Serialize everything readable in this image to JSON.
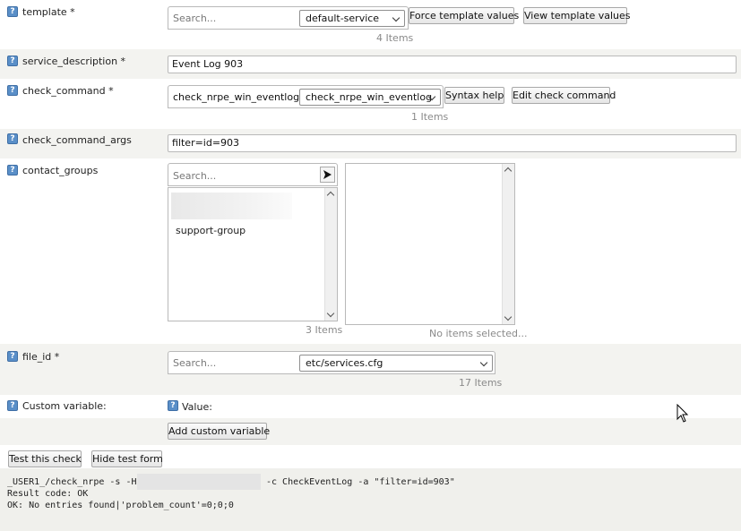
{
  "template": {
    "label": "template *",
    "search_placeholder": "Search...",
    "selected": "default-service",
    "force_button": "Force template values",
    "view_button": "View template values",
    "count": "4 Items"
  },
  "service_description": {
    "label": "service_description *",
    "value": "Event Log 903"
  },
  "check_command": {
    "label": "check_command *",
    "search_value": "check_nrpe_win_eventlog",
    "selected": "check_nrpe_win_eventlog",
    "syntax_button": "Syntax help",
    "edit_button": "Edit check command",
    "count": "1 Items"
  },
  "check_command_args": {
    "label": "check_command_args",
    "value": "filter=id=903"
  },
  "contact_groups": {
    "label": "contact_groups",
    "search_placeholder": "Search...",
    "items": [
      "support-group"
    ],
    "available_count": "3 Items",
    "selected_placeholder": "No items selected..."
  },
  "file_id": {
    "label": "file_id *",
    "search_placeholder": "Search...",
    "selected": "etc/services.cfg",
    "count": "17 Items"
  },
  "custom_variable": {
    "label": "Custom variable:",
    "value_label": "Value:",
    "add_button": "Add custom variable"
  },
  "test": {
    "test_button": "Test this check",
    "hide_button": "Hide test form",
    "cmd_prefix": "_USER1_/check_nrpe -s -H",
    "cmd_suffix": "-c CheckEventLog -a \"filter=id=903\"",
    "result_code": "Result code: OK",
    "output": "OK: No entries found|'problem_count'=0;0;0"
  },
  "colors": {
    "row_shade": "#f3f3f0",
    "help_icon": "#5a8fc8",
    "count_text": "#8a8a8a"
  },
  "icons": [
    "help-icon",
    "chevron-down-icon",
    "send-arrow-icon",
    "scroll-up-arrow-icon",
    "scroll-down-arrow-icon",
    "mouse-cursor-icon"
  ]
}
